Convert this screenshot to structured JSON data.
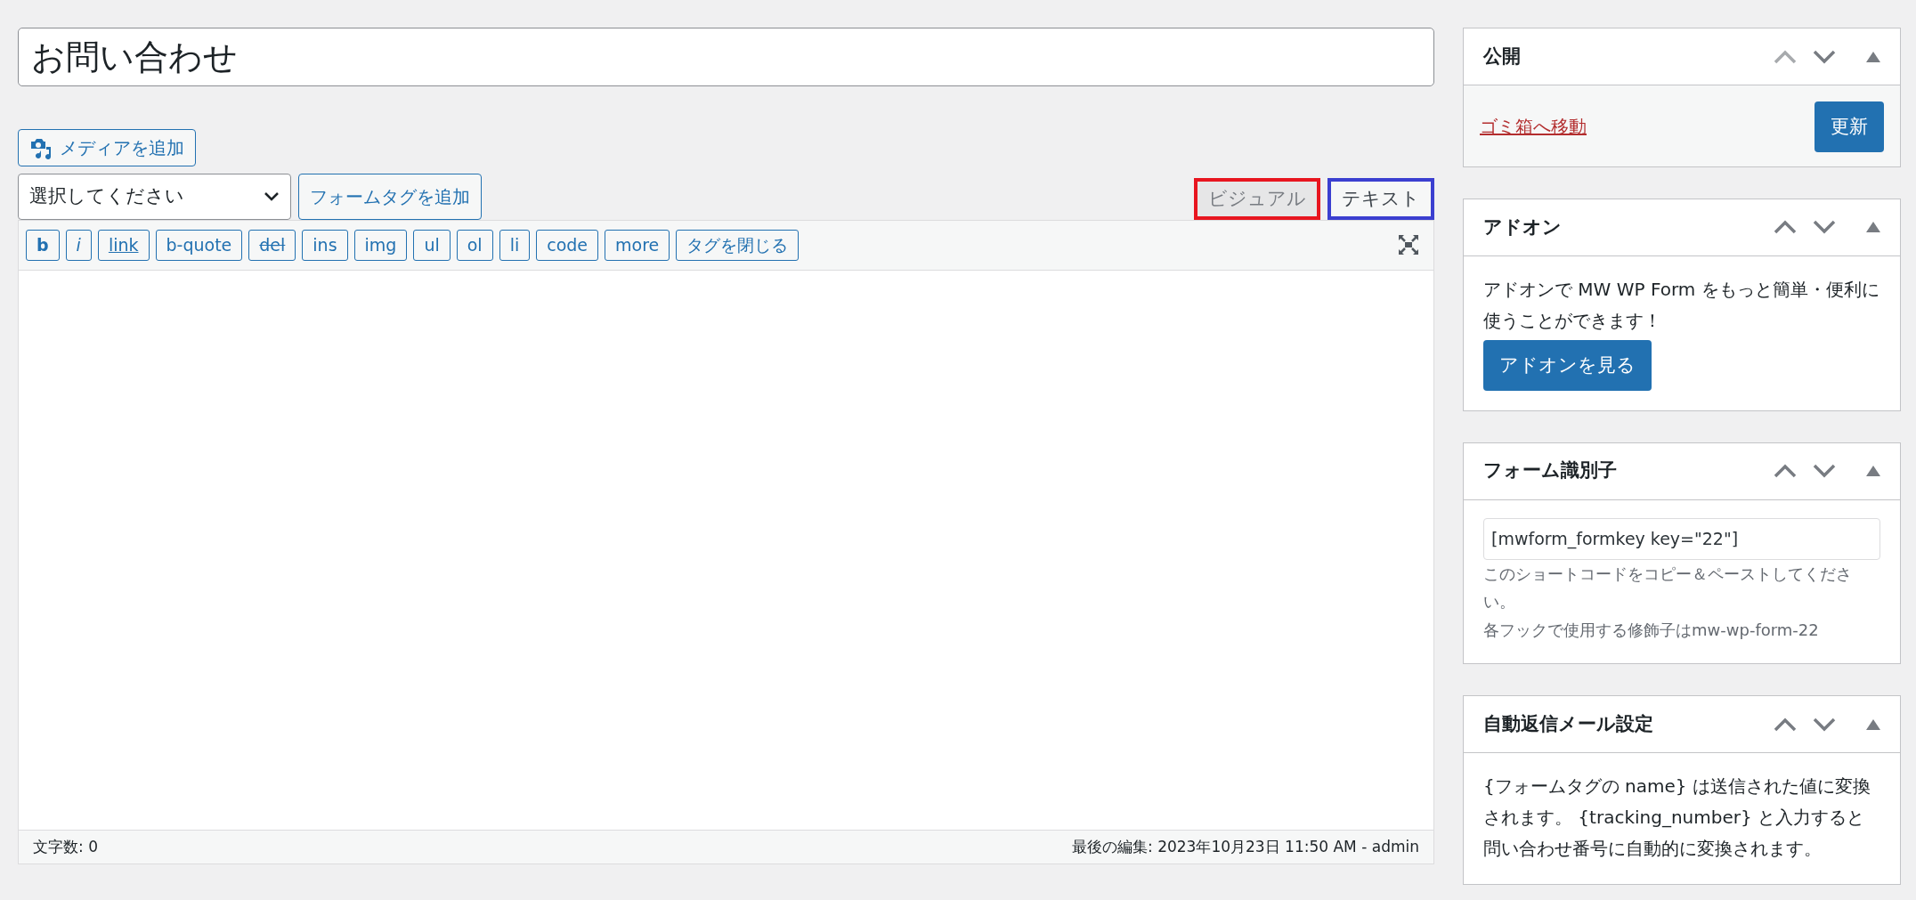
{
  "title_field": {
    "value": "お問い合わせ"
  },
  "editor": {
    "media_button": "メディアを追加",
    "tag_select": {
      "value": "選択してください"
    },
    "add_tag_button": "フォームタグを追加",
    "tabs": [
      {
        "label": "ビジュアル",
        "selected": false,
        "color": "#e8151f"
      },
      {
        "label": "テキスト",
        "selected": true,
        "color": "#3b3fd0"
      }
    ],
    "quicktags": [
      {
        "label": "b",
        "kind": "bold"
      },
      {
        "label": "i",
        "kind": "italic"
      },
      {
        "label": "link",
        "kind": "underline"
      },
      {
        "label": "b-quote",
        "kind": "plain"
      },
      {
        "label": "del",
        "kind": "strike"
      },
      {
        "label": "ins",
        "kind": "plain"
      },
      {
        "label": "img",
        "kind": "plain"
      },
      {
        "label": "ul",
        "kind": "plain"
      },
      {
        "label": "ol",
        "kind": "plain"
      },
      {
        "label": "li",
        "kind": "plain"
      },
      {
        "label": "code",
        "kind": "plain"
      },
      {
        "label": "more",
        "kind": "plain"
      },
      {
        "label": "タグを閉じる",
        "kind": "plain"
      }
    ],
    "status_bar": {
      "word_count": "文字数: 0",
      "last_edit": "最後の編集: 2023年10月23日 11:50 AM - admin"
    }
  },
  "sidebar": [
    {
      "kind": "publish",
      "title": "公開",
      "move_up_disabled": true,
      "trash_link": "ゴミ箱へ移動",
      "button": "更新"
    },
    {
      "kind": "addon",
      "title": "アドオン",
      "move_up_disabled": false,
      "text": "アドオンで MW WP Form をもっと簡単・便利に使うことができます！",
      "button": "アドオンを見る"
    },
    {
      "kind": "formkey",
      "title": "フォーム識別子",
      "move_up_disabled": false,
      "field": "[mwform_formkey key=\"22\"]",
      "notes": [
        "このショートコードをコピー＆ペーストしてください。",
        "各フックで使用する修飾子はmw-wp-form-22"
      ]
    },
    {
      "kind": "autoreply",
      "title": "自動返信メール設定",
      "move_up_disabled": false,
      "text": "{フォームタグの name} は送信された値に変換されます。 {tracking_number} と入力すると問い合わせ番号に自動的に変換されます。"
    }
  ]
}
